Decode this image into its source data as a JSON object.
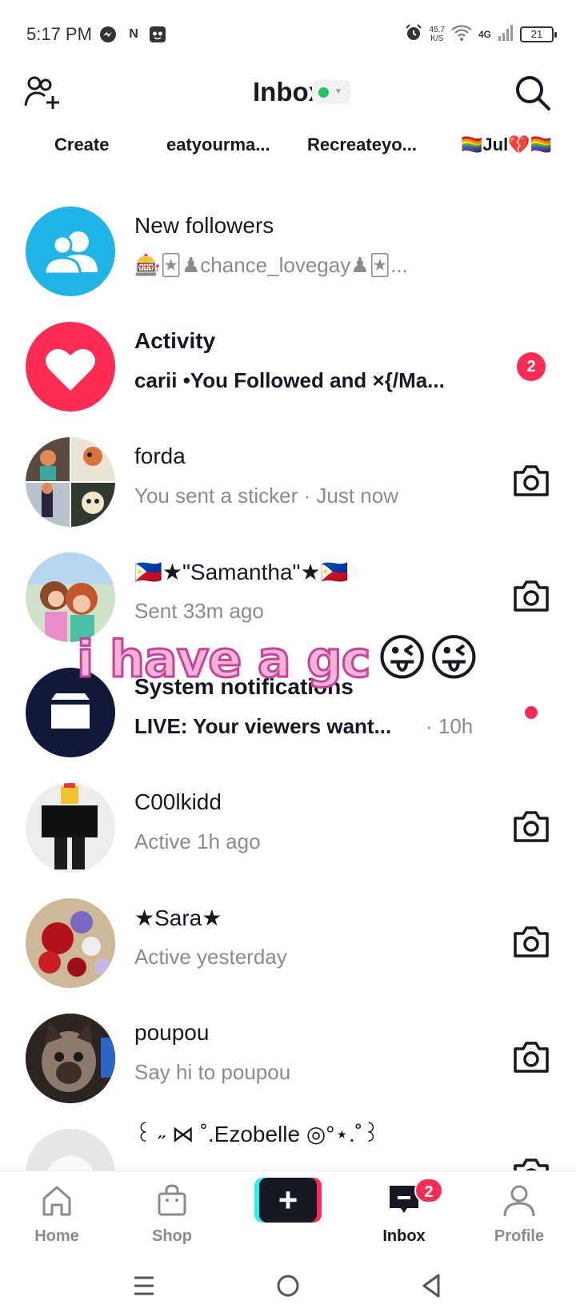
{
  "status_bar": {
    "time": "5:17 PM",
    "net_speed": "45.7\nK/S",
    "network": "4G",
    "battery": "21"
  },
  "header": {
    "title": "Inbox",
    "status_color": "#22c55e"
  },
  "stories": [
    "Create",
    "eatyourma...",
    "Recreateyo...",
    "🏳️‍🌈Jul💔🏳️‍🌈"
  ],
  "rows": [
    {
      "title": "New followers",
      "subtitle": "🎰🃏♟chance_lovegay♟🃏...",
      "icon": "followers-icon",
      "avatar_color": "#20b4e8"
    },
    {
      "title": "Activity",
      "subtitle": "carii •You Followed and ×{/Ma...",
      "icon": "heart-icon",
      "avatar_color": "#fe2c55",
      "badge": "2"
    },
    {
      "title": "forda",
      "subtitle": "You sent a sticker · Just now"
    },
    {
      "title": "🇵🇭★\"Samantha\"★🇵🇭",
      "subtitle": "Sent 33m ago"
    },
    {
      "title": "System notifications",
      "subtitle": "LIVE: Your viewers want...",
      "time": "· 10h",
      "icon": "inbox-box-icon",
      "avatar_color": "#11183a"
    },
    {
      "title": "C00lkidd",
      "subtitle": "Active 1h ago"
    },
    {
      "title": "★Sara★",
      "subtitle": "Active yesterday"
    },
    {
      "title": "poupou",
      "subtitle": "Say hi to poupou"
    },
    {
      "title": "꒰ ˶ ⋈ ˚.Ezobelle ◎°⋆.˚꒱",
      "subtitle": ""
    }
  ],
  "overlay": {
    "text": "i have a gc",
    "emoji": "😜😜"
  },
  "bottom_nav": {
    "home": "Home",
    "shop": "Shop",
    "plus": "+",
    "inbox": "Inbox",
    "inbox_badge": "2",
    "profile": "Profile"
  },
  "colors": {
    "accent": "#fe2c55",
    "cyan": "#25f4ee",
    "text": "#161823",
    "muted": "#8a8b91"
  }
}
